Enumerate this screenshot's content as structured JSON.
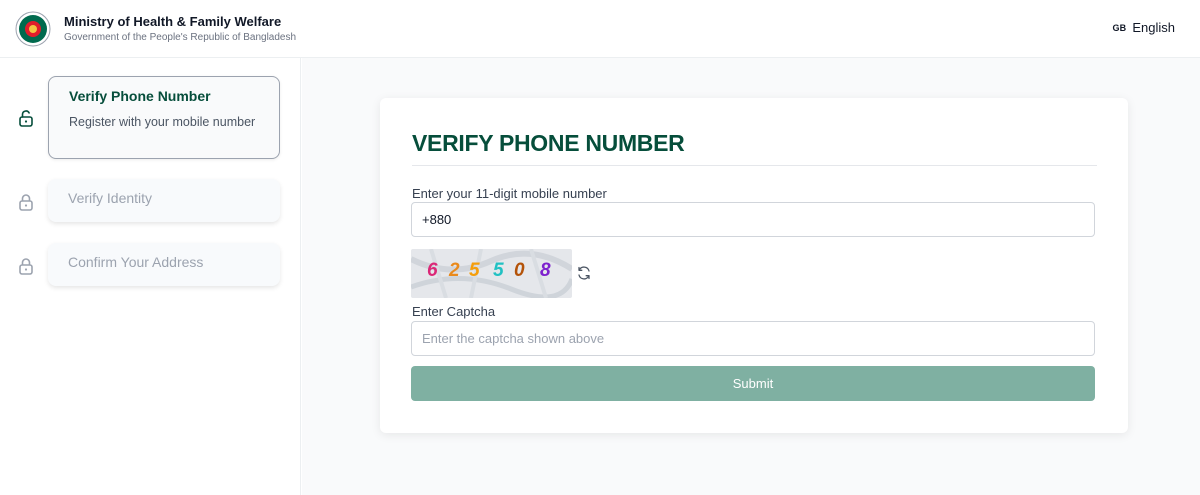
{
  "header": {
    "org_name": "Ministry of Health & Family Welfare",
    "org_subtitle": "Government of the People's Republic of Bangladesh",
    "language_code": "GB",
    "language_label": "English"
  },
  "steps": [
    {
      "title": "Verify Phone Number",
      "description": "Register with your mobile number",
      "state": "active",
      "icon": "lock-open-icon"
    },
    {
      "title": "Verify Identity",
      "state": "locked",
      "icon": "lock-icon"
    },
    {
      "title": "Confirm Your Address",
      "state": "locked",
      "icon": "lock-icon"
    }
  ],
  "form": {
    "title": "VERIFY PHONE NUMBER",
    "phone_label": "Enter your 11-digit mobile number",
    "phone_value": "+880",
    "captcha_digits": [
      "6",
      "2",
      "5",
      "5",
      "0",
      "8"
    ],
    "captcha_colors": [
      "#db2777",
      "#ea8a1c",
      "#f59e0b",
      "#22c1c3",
      "#b45309",
      "#7e22ce"
    ],
    "captcha_label": "Enter Captcha",
    "captcha_placeholder": "Enter the captcha shown above",
    "submit_label": "Submit"
  },
  "colors": {
    "brand": "#064e3b",
    "submit_bg": "#7fb0a2"
  }
}
